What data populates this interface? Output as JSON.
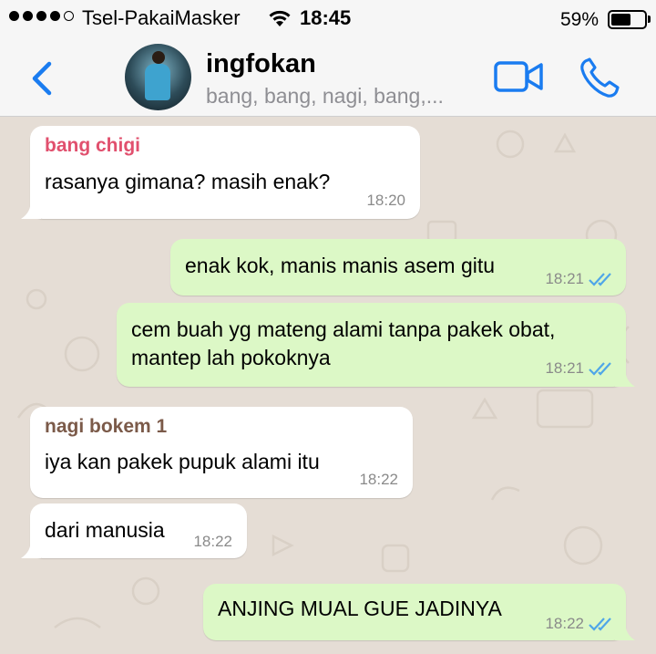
{
  "status_bar": {
    "carrier": "Tsel-PakaiMasker",
    "time": "18:45",
    "battery_percent": "59%",
    "battery_level": 0.59,
    "signal_bars": 4,
    "signal_max": 5
  },
  "header": {
    "contact_name": "ingfokan",
    "members": "bang, bang, nagi, bang,..."
  },
  "colors": {
    "accent": "#1a7cf0",
    "outgoing_bubble": "#dcf8c6",
    "incoming_bubble": "#ffffff",
    "chat_background": "#e5ddd5",
    "read_ticks": "#4fa6e8"
  },
  "messages": [
    {
      "direction": "in",
      "sender": "bang chigi",
      "sender_color": "#e1506e",
      "text": "rasanya gimana? masih enak?",
      "time": "18:20"
    },
    {
      "direction": "out",
      "text": "enak kok, manis manis asem gitu",
      "time": "18:21",
      "read": true
    },
    {
      "direction": "out",
      "text_line1": "cem buah yg mateng alami tanpa pakek obat,",
      "text_line2": "mantep lah pokoknya",
      "time": "18:21",
      "read": true
    },
    {
      "direction": "in",
      "sender": "nagi bokem 1",
      "sender_color": "#7b5a49",
      "text": "iya kan pakek pupuk alami itu",
      "time": "18:22"
    },
    {
      "direction": "in",
      "text": "dari manusia",
      "time": "18:22"
    },
    {
      "direction": "out",
      "text": "ANJING MUAL GUE JADINYA",
      "time": "18:22",
      "read": true
    }
  ]
}
